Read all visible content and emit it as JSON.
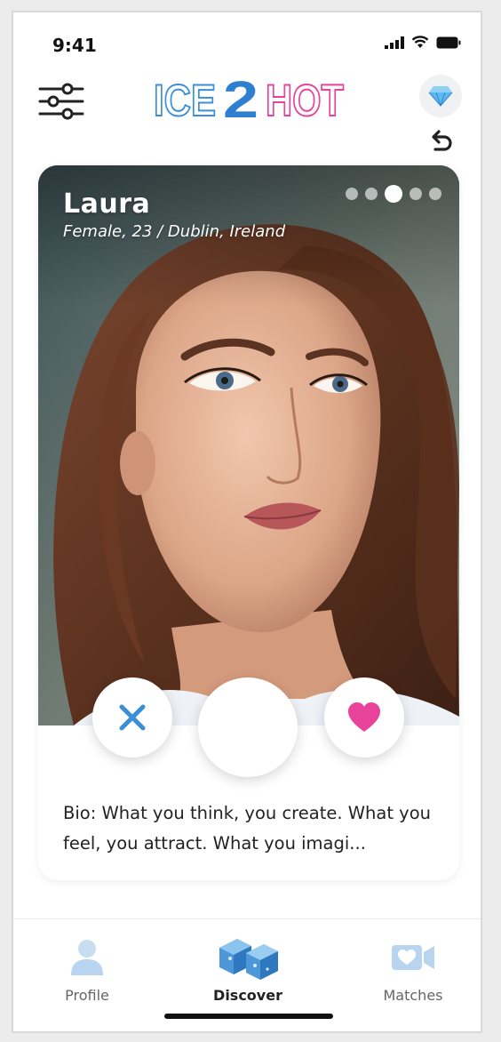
{
  "status_bar": {
    "time": "9:41"
  },
  "header": {
    "logo": {
      "left": "ICE",
      "mid": "2",
      "right": "HOT"
    },
    "filter_icon": "sliders-icon",
    "premium_icon": "diamond-icon",
    "undo_icon": "undo-icon"
  },
  "profile": {
    "name": "Laura",
    "details": "Female, 23 / Dublin, Ireland",
    "photo_count": 5,
    "active_photo": 3,
    "bio": "Bio: What you think, you create. What you feel, you attract. What you imagi..."
  },
  "actions": {
    "dislike_icon": "close-icon",
    "neutral_icon": "blank-circle",
    "like_icon": "heart-icon"
  },
  "tabs": [
    {
      "label": "Profile",
      "icon": "person-icon",
      "active": false
    },
    {
      "label": "Discover",
      "icon": "ice-cubes-icon",
      "active": true
    },
    {
      "label": "Matches",
      "icon": "video-heart-icon",
      "active": false
    }
  ],
  "colors": {
    "ice_blue": "#3b8fd6",
    "hot_pink": "#e8439a",
    "tab_inactive_blue": "#b9d4ee"
  }
}
